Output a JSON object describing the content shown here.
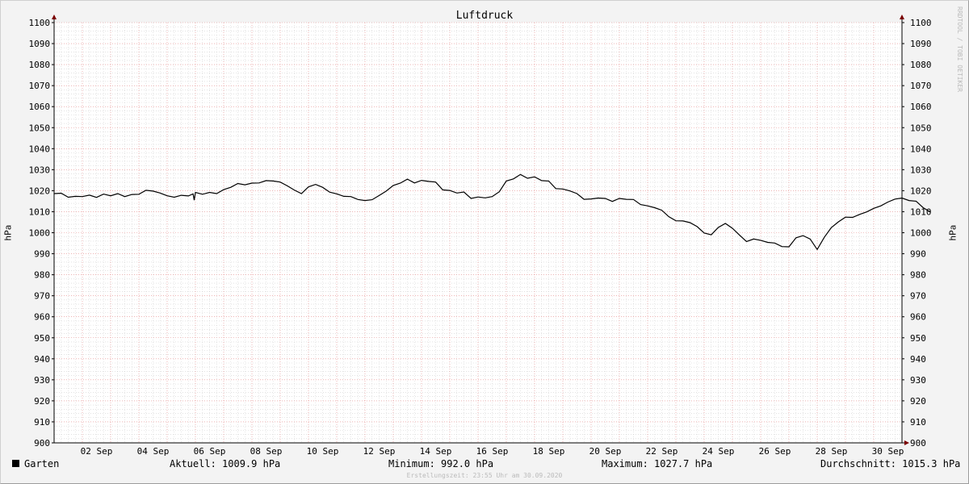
{
  "chart_data": {
    "type": "line",
    "title": "Luftdruck",
    "ylabel": "hPa",
    "ylim": [
      900,
      1100
    ],
    "y_ticks": [
      900,
      910,
      920,
      930,
      940,
      950,
      960,
      970,
      980,
      990,
      1000,
      1010,
      1020,
      1030,
      1040,
      1050,
      1060,
      1070,
      1080,
      1090,
      1100
    ],
    "x_range": [
      "2020-09-01T00:00",
      "2020-10-01T00:00"
    ],
    "x_ticks": [
      {
        "date": "2020-09-02",
        "label": "02 Sep"
      },
      {
        "date": "2020-09-04",
        "label": "04 Sep"
      },
      {
        "date": "2020-09-06",
        "label": "06 Sep"
      },
      {
        "date": "2020-09-08",
        "label": "08 Sep"
      },
      {
        "date": "2020-09-10",
        "label": "10 Sep"
      },
      {
        "date": "2020-09-12",
        "label": "12 Sep"
      },
      {
        "date": "2020-09-14",
        "label": "14 Sep"
      },
      {
        "date": "2020-09-16",
        "label": "16 Sep"
      },
      {
        "date": "2020-09-18",
        "label": "18 Sep"
      },
      {
        "date": "2020-09-20",
        "label": "20 Sep"
      },
      {
        "date": "2020-09-22",
        "label": "22 Sep"
      },
      {
        "date": "2020-09-24",
        "label": "24 Sep"
      },
      {
        "date": "2020-09-26",
        "label": "26 Sep"
      },
      {
        "date": "2020-09-28",
        "label": "28 Sep"
      },
      {
        "date": "2020-09-30",
        "label": "30 Sep"
      }
    ],
    "grid": true,
    "series": [
      {
        "name": "Garten",
        "color": "#000000",
        "points": [
          [
            "2020-09-01T00:00",
            1018.6
          ],
          [
            "2020-09-01T06:00",
            1018.8
          ],
          [
            "2020-09-01T12:00",
            1016.9
          ],
          [
            "2020-09-01T18:00",
            1017.3
          ],
          [
            "2020-09-02T00:00",
            1017.2
          ],
          [
            "2020-09-02T06:00",
            1017.9
          ],
          [
            "2020-09-02T12:00",
            1016.8
          ],
          [
            "2020-09-02T18:00",
            1018.4
          ],
          [
            "2020-09-03T00:00",
            1017.6
          ],
          [
            "2020-09-03T06:00",
            1018.6
          ],
          [
            "2020-09-03T12:00",
            1017.2
          ],
          [
            "2020-09-03T18:00",
            1018.2
          ],
          [
            "2020-09-04T00:00",
            1018.3
          ],
          [
            "2020-09-04T06:00",
            1020.2
          ],
          [
            "2020-09-04T12:00",
            1019.8
          ],
          [
            "2020-09-04T18:00",
            1018.9
          ],
          [
            "2020-09-05T00:00",
            1017.6
          ],
          [
            "2020-09-05T06:00",
            1016.9
          ],
          [
            "2020-09-05T12:00",
            1017.8
          ],
          [
            "2020-09-05T18:00",
            1017.5
          ],
          [
            "2020-09-05T22:00",
            1018.5
          ],
          [
            "2020-09-05T23:00",
            1015.5
          ],
          [
            "2020-09-06T00:00",
            1019.2
          ],
          [
            "2020-09-06T06:00",
            1018.3
          ],
          [
            "2020-09-06T12:00",
            1019.2
          ],
          [
            "2020-09-06T18:00",
            1018.6
          ],
          [
            "2020-09-07T00:00",
            1020.5
          ],
          [
            "2020-09-07T06:00",
            1021.6
          ],
          [
            "2020-09-07T12:00",
            1023.4
          ],
          [
            "2020-09-07T18:00",
            1022.8
          ],
          [
            "2020-09-08T00:00",
            1023.6
          ],
          [
            "2020-09-08T06:00",
            1023.7
          ],
          [
            "2020-09-08T12:00",
            1024.8
          ],
          [
            "2020-09-08T18:00",
            1024.6
          ],
          [
            "2020-09-09T00:00",
            1024.1
          ],
          [
            "2020-09-09T06:00",
            1022.3
          ],
          [
            "2020-09-09T12:00",
            1020.3
          ],
          [
            "2020-09-09T18:00",
            1018.6
          ],
          [
            "2020-09-10T00:00",
            1021.8
          ],
          [
            "2020-09-10T06:00",
            1023.0
          ],
          [
            "2020-09-10T12:00",
            1021.6
          ],
          [
            "2020-09-10T18:00",
            1019.3
          ],
          [
            "2020-09-11T00:00",
            1018.5
          ],
          [
            "2020-09-11T06:00",
            1017.3
          ],
          [
            "2020-09-11T12:00",
            1017.2
          ],
          [
            "2020-09-11T18:00",
            1015.8
          ],
          [
            "2020-09-12T00:00",
            1015.3
          ],
          [
            "2020-09-12T06:00",
            1015.7
          ],
          [
            "2020-09-12T12:00",
            1017.7
          ],
          [
            "2020-09-12T18:00",
            1019.8
          ],
          [
            "2020-09-13T00:00",
            1022.5
          ],
          [
            "2020-09-13T06:00",
            1023.6
          ],
          [
            "2020-09-13T12:00",
            1025.5
          ],
          [
            "2020-09-13T18:00",
            1023.7
          ],
          [
            "2020-09-14T00:00",
            1024.9
          ],
          [
            "2020-09-14T06:00",
            1024.4
          ],
          [
            "2020-09-14T12:00",
            1024.1
          ],
          [
            "2020-09-14T18:00",
            1020.4
          ],
          [
            "2020-09-15T00:00",
            1020.1
          ],
          [
            "2020-09-15T06:00",
            1018.9
          ],
          [
            "2020-09-15T12:00",
            1019.4
          ],
          [
            "2020-09-15T18:00",
            1016.3
          ],
          [
            "2020-09-16T00:00",
            1017.0
          ],
          [
            "2020-09-16T06:00",
            1016.6
          ],
          [
            "2020-09-16T12:00",
            1017.2
          ],
          [
            "2020-09-16T18:00",
            1019.5
          ],
          [
            "2020-09-17T00:00",
            1024.6
          ],
          [
            "2020-09-17T06:00",
            1025.6
          ],
          [
            "2020-09-17T12:00",
            1027.7
          ],
          [
            "2020-09-17T18:00",
            1025.9
          ],
          [
            "2020-09-18T00:00",
            1026.6
          ],
          [
            "2020-09-18T06:00",
            1024.8
          ],
          [
            "2020-09-18T12:00",
            1024.6
          ],
          [
            "2020-09-18T18:00",
            1021.0
          ],
          [
            "2020-09-19T00:00",
            1020.8
          ],
          [
            "2020-09-19T06:00",
            1019.9
          ],
          [
            "2020-09-19T12:00",
            1018.6
          ],
          [
            "2020-09-19T18:00",
            1015.9
          ],
          [
            "2020-09-20T00:00",
            1016.1
          ],
          [
            "2020-09-20T06:00",
            1016.5
          ],
          [
            "2020-09-20T12:00",
            1016.3
          ],
          [
            "2020-09-20T18:00",
            1014.9
          ],
          [
            "2020-09-21T00:00",
            1016.3
          ],
          [
            "2020-09-21T06:00",
            1015.9
          ],
          [
            "2020-09-21T12:00",
            1015.8
          ],
          [
            "2020-09-21T18:00",
            1013.4
          ],
          [
            "2020-09-22T00:00",
            1012.8
          ],
          [
            "2020-09-22T06:00",
            1011.9
          ],
          [
            "2020-09-22T12:00",
            1010.7
          ],
          [
            "2020-09-22T18:00",
            1007.6
          ],
          [
            "2020-09-23T00:00",
            1005.7
          ],
          [
            "2020-09-23T06:00",
            1005.6
          ],
          [
            "2020-09-23T12:00",
            1004.8
          ],
          [
            "2020-09-23T18:00",
            1002.9
          ],
          [
            "2020-09-24T00:00",
            999.9
          ],
          [
            "2020-09-24T06:00",
            999.0
          ],
          [
            "2020-09-24T12:00",
            1002.5
          ],
          [
            "2020-09-24T18:00",
            1004.4
          ],
          [
            "2020-09-25T00:00",
            1002.1
          ],
          [
            "2020-09-25T06:00",
            998.9
          ],
          [
            "2020-09-25T12:00",
            995.8
          ],
          [
            "2020-09-25T18:00",
            997.0
          ],
          [
            "2020-09-26T00:00",
            996.4
          ],
          [
            "2020-09-26T06:00",
            995.4
          ],
          [
            "2020-09-26T12:00",
            995.1
          ],
          [
            "2020-09-26T18:00",
            993.4
          ],
          [
            "2020-09-27T00:00",
            993.3
          ],
          [
            "2020-09-27T06:00",
            997.6
          ],
          [
            "2020-09-27T12:00",
            998.6
          ],
          [
            "2020-09-27T18:00",
            997.0
          ],
          [
            "2020-09-28T00:00",
            992.0
          ],
          [
            "2020-09-28T06:00",
            997.8
          ],
          [
            "2020-09-28T12:00",
            1002.4
          ],
          [
            "2020-09-28T18:00",
            1005.2
          ],
          [
            "2020-09-29T00:00",
            1007.4
          ],
          [
            "2020-09-29T06:00",
            1007.3
          ],
          [
            "2020-09-29T12:00",
            1008.7
          ],
          [
            "2020-09-29T18:00",
            1009.9
          ],
          [
            "2020-09-30T00:00",
            1011.6
          ],
          [
            "2020-09-30T06:00",
            1012.8
          ],
          [
            "2020-09-30T12:00",
            1014.6
          ],
          [
            "2020-09-30T18:00",
            1016.0
          ],
          [
            "2020-10-01T00:00",
            1016.5
          ],
          [
            "2020-10-01T06:00",
            1015.3
          ],
          [
            "2020-10-01T12:00",
            1015.0
          ],
          [
            "2020-10-01T18:00",
            1011.9
          ],
          [
            "2020-10-01T23:55",
            1009.9
          ]
        ]
      }
    ]
  },
  "legend": {
    "name": "Garten",
    "current": "Aktuell: 1009.9 hPa",
    "minimum": "Minimum: 992.0 hPa",
    "maximum": "Maximum: 1027.7 hPa",
    "average": "Durchschnitt: 1015.3 hPa"
  },
  "footer": "Erstellungszeit: 23:55 Uhr am 30.09.2020",
  "watermark": "RRDTOOL / TOBI OETIKER",
  "colors": {
    "background": "#f3f3f3",
    "canvas": "#ffffff",
    "major_grid": "#e07a7a",
    "minor_grid": "#bdbdbd",
    "arrow": "#7a0000"
  }
}
